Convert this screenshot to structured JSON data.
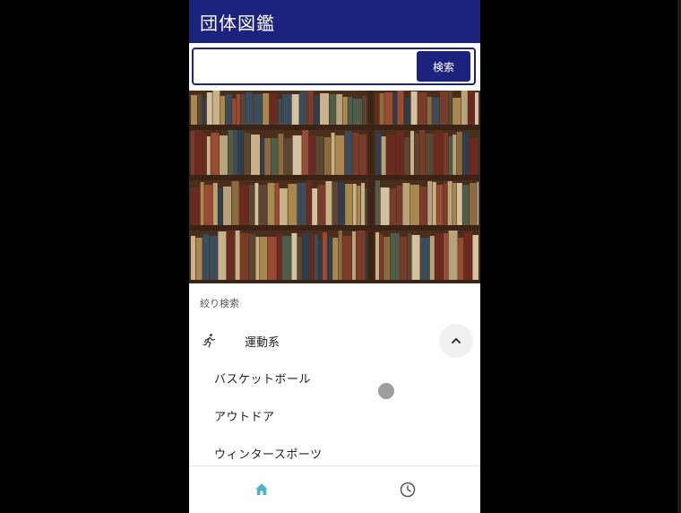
{
  "app": {
    "title": "団体図鑑"
  },
  "search": {
    "placeholder": "",
    "button_label": "検索"
  },
  "filter": {
    "section_label": "絞り検索",
    "category": {
      "label": "運動系",
      "icon": "running-icon",
      "expanded": true
    },
    "subitems": [
      {
        "label": "バスケットボール"
      },
      {
        "label": "アウトドア"
      },
      {
        "label": "ウィンタースポーツ"
      }
    ]
  },
  "bottom_nav": [
    {
      "icon": "home-icon",
      "active": true
    },
    {
      "icon": "clock-icon",
      "active": false
    }
  ],
  "colors": {
    "primary": "#1c237e",
    "accent": "#4fb3c7"
  }
}
